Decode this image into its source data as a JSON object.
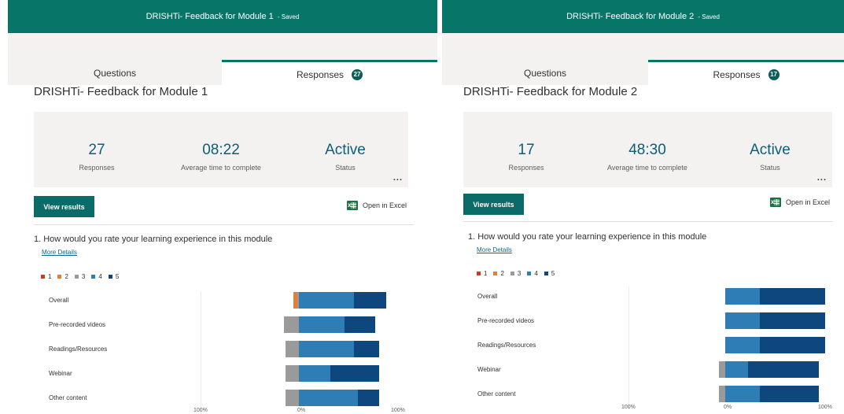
{
  "colors": {
    "accent": "#077568",
    "rating_1": "#c3401c",
    "rating_2": "#ea7b2f",
    "rating_3": "#9a9a9a",
    "rating_4": "#2e7eb5",
    "rating_5": "#0e477d"
  },
  "forms": [
    {
      "titlebar": {
        "title": "DRISHTi- Feedback for Module 1",
        "saved": "- Saved"
      },
      "tabs": {
        "questions": "Questions",
        "responses": "Responses",
        "responses_count": "27"
      },
      "form_title": "DRISHTi- Feedback for Module 1",
      "summary": {
        "responses": {
          "value": "27",
          "label": "Responses"
        },
        "avg_time": {
          "value": "08:22",
          "label": "Average time to complete"
        },
        "status": {
          "value": "Active",
          "label": "Status"
        },
        "more": "..."
      },
      "view_results": "View results",
      "open_excel": "Open in Excel",
      "question": {
        "text": "1.  How would you rate your learning experience in this module",
        "more_details": "More Details",
        "legend": [
          "1",
          "2",
          "3",
          "4",
          "5"
        ],
        "axis_labels": [
          "100%",
          "0%",
          "100%"
        ],
        "rows": [
          {
            "label": "Overall",
            "pct": [
              0,
              4,
              2,
              58,
              34
            ]
          },
          {
            "label": "Pre-recorded videos",
            "pct": [
              0,
              0,
              16,
              48,
              32
            ]
          },
          {
            "label": "Readings/Resources",
            "pct": [
              0,
              0,
              14,
              58,
              26
            ]
          },
          {
            "label": "Webinar",
            "pct": [
              0,
              0,
              14,
              33,
              51
            ]
          },
          {
            "label": "Other content",
            "pct": [
              0,
              0,
              14,
              62,
              22
            ]
          }
        ]
      }
    },
    {
      "titlebar": {
        "title": "DRISHTi- Feedback for Module 2",
        "saved": "- Saved"
      },
      "tabs": {
        "questions": "Questions",
        "responses": "Responses",
        "responses_count": "17"
      },
      "form_title": "DRISHTi- Feedback for Module 2",
      "summary": {
        "responses": {
          "value": "17",
          "label": "Responses"
        },
        "avg_time": {
          "value": "48:30",
          "label": "Average time to complete"
        },
        "status": {
          "value": "Active",
          "label": "Status"
        },
        "more": "..."
      },
      "view_results": "View results",
      "open_excel": "Open in Excel",
      "question": {
        "text": "1.  How would you rate your learning experience in this module",
        "more_details": "More Details",
        "legend": [
          "1",
          "2",
          "3",
          "4",
          "5"
        ],
        "axis_labels": [
          "100%",
          "0%",
          "100%"
        ],
        "rows": [
          {
            "label": "Overall",
            "pct": [
              0,
              0,
              0,
              35,
              65
            ]
          },
          {
            "label": "Pre-recorded videos",
            "pct": [
              0,
              0,
              0,
              35,
              65
            ]
          },
          {
            "label": "Readings/Resources",
            "pct": [
              0,
              0,
              0,
              35,
              65
            ]
          },
          {
            "label": "Webinar",
            "pct": [
              0,
              0,
              6,
              23,
              71
            ]
          },
          {
            "label": "Other content",
            "pct": [
              0,
              0,
              6,
              35,
              59
            ]
          }
        ]
      }
    }
  ]
}
